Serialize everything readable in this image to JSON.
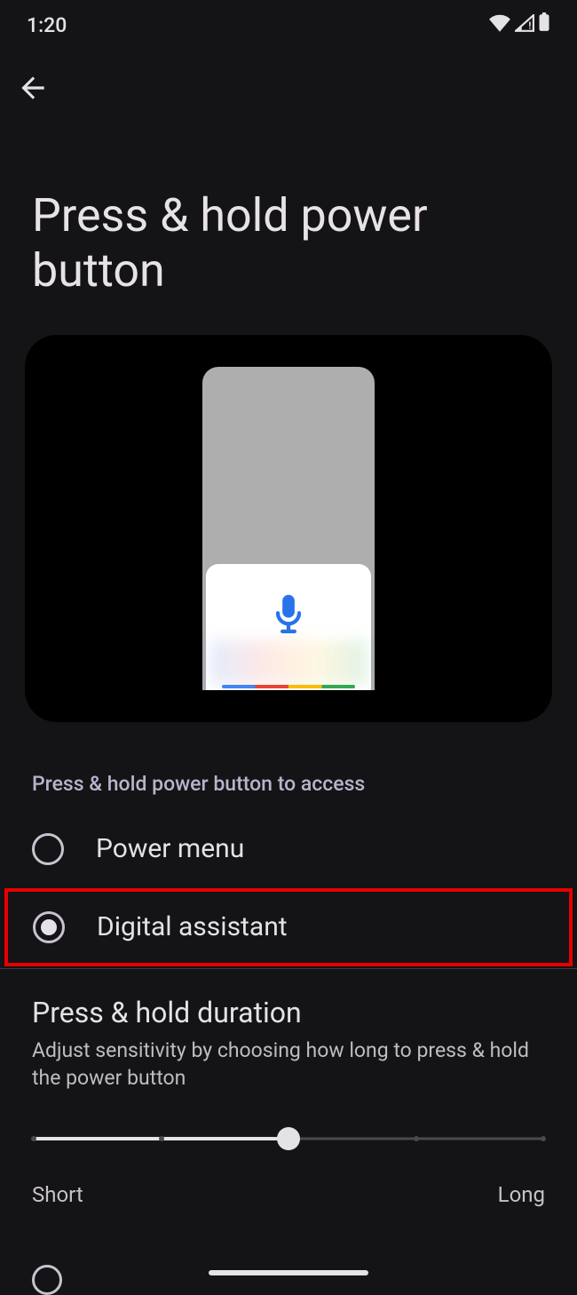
{
  "status": {
    "time": "1:20"
  },
  "page": {
    "title": "Press & hold power button"
  },
  "section": {
    "header": "Press & hold power button to access"
  },
  "options": {
    "power_menu": {
      "label": "Power menu",
      "selected": false
    },
    "digital_assistant": {
      "label": "Digital assistant",
      "selected": true
    }
  },
  "duration": {
    "title": "Press & hold duration",
    "description": "Adjust sensitivity by choosing how long to press & hold the power button",
    "min_label": "Short",
    "max_label": "Long",
    "value_percent": 50
  }
}
